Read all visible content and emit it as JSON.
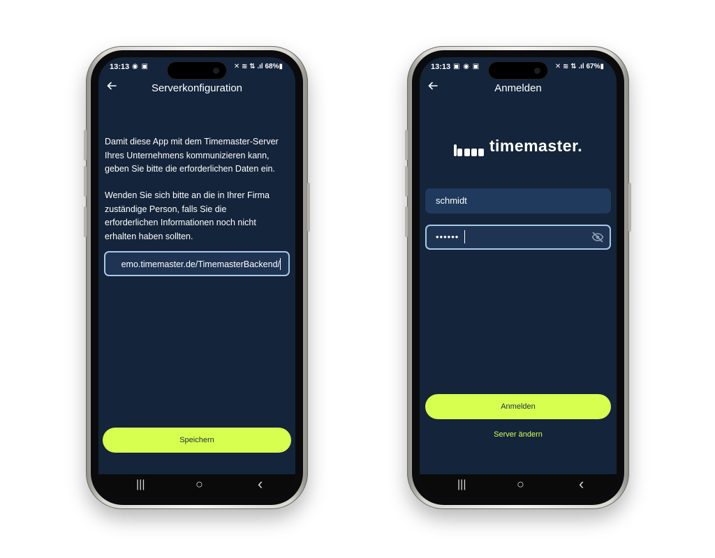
{
  "left_phone": {
    "status": {
      "time": "13:13",
      "left_icons": "◉ ▣",
      "right_icons": "✕ ≋ ⇅ .ıl 68%▮"
    },
    "header": {
      "back_icon": "arrow-left-icon",
      "title": "Serverkonfiguration"
    },
    "paragraphs": [
      [
        "Damit diese App mit dem Timemaster-Server",
        "Ihres Unternehmens kommunizieren kann,",
        "geben Sie bitte die erforderlichen Daten ein."
      ],
      [
        "Wenden Sie sich bitte an die in Ihrer Firma",
        "zuständige Person, falls Sie die",
        "erforderlichen Informationen noch nicht",
        "erhalten haben sollten."
      ]
    ],
    "server_url_value": "emo.timemaster.de/TimemasterBackend/",
    "save_button": "Speichern",
    "nav": {
      "recents": "|||",
      "home": "○",
      "back": "‹"
    }
  },
  "right_phone": {
    "status": {
      "time": "13:13",
      "left_icons": "▣ ◉ ▣",
      "right_icons": "✕ ≋ ⇅ .ıl 67%▮"
    },
    "header": {
      "back_icon": "arrow-left-icon",
      "title": "Anmelden"
    },
    "logo_text": "timemaster.",
    "username_value": "schmidt",
    "password_value": "••••••",
    "login_button": "Anmelden",
    "change_server_link": "Server ändern",
    "nav": {
      "recents": "|||",
      "home": "○",
      "back": "‹"
    }
  },
  "colors": {
    "screen_bg": "#14243a",
    "accent": "#d6ff4f",
    "field_bg": "#1f3a5c",
    "focus_border": "#a9c9e8"
  }
}
